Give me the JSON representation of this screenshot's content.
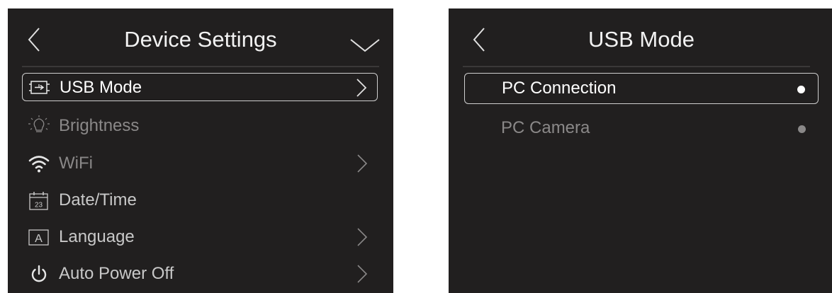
{
  "device_settings": {
    "title": "Device Settings",
    "back_icon": "chevron-left-icon",
    "menu_icon": "chevron-down-icon",
    "items": [
      {
        "label": "USB Mode",
        "icon": "usb-mode-icon",
        "selected": true,
        "has_submenu": true
      },
      {
        "label": "Brightness",
        "icon": "brightness-bulb-icon",
        "selected": false,
        "has_submenu": false
      },
      {
        "label": "WiFi",
        "icon": "wifi-icon",
        "selected": false,
        "has_submenu": true
      },
      {
        "label": "Date/Time",
        "icon": "calendar-icon",
        "calendar_day": "23",
        "selected": false,
        "has_submenu": false
      },
      {
        "label": "Language",
        "icon": "language-a-icon",
        "icon_letter": "A",
        "selected": false,
        "has_submenu": true
      },
      {
        "label": "Auto Power Off",
        "icon": "power-icon",
        "selected": false,
        "has_submenu": true
      }
    ]
  },
  "usb_mode": {
    "title": "USB Mode",
    "back_icon": "chevron-left-icon",
    "options": [
      {
        "label": "PC Connection",
        "selected": true
      },
      {
        "label": "PC Camera",
        "selected": false
      }
    ]
  },
  "colors": {
    "panel_background": "#211f1f",
    "selected_text": "#ffffff",
    "normal_text": "#c8c8c8",
    "dim_text": "#8a8888",
    "selection_border": "#cfcfcf"
  }
}
